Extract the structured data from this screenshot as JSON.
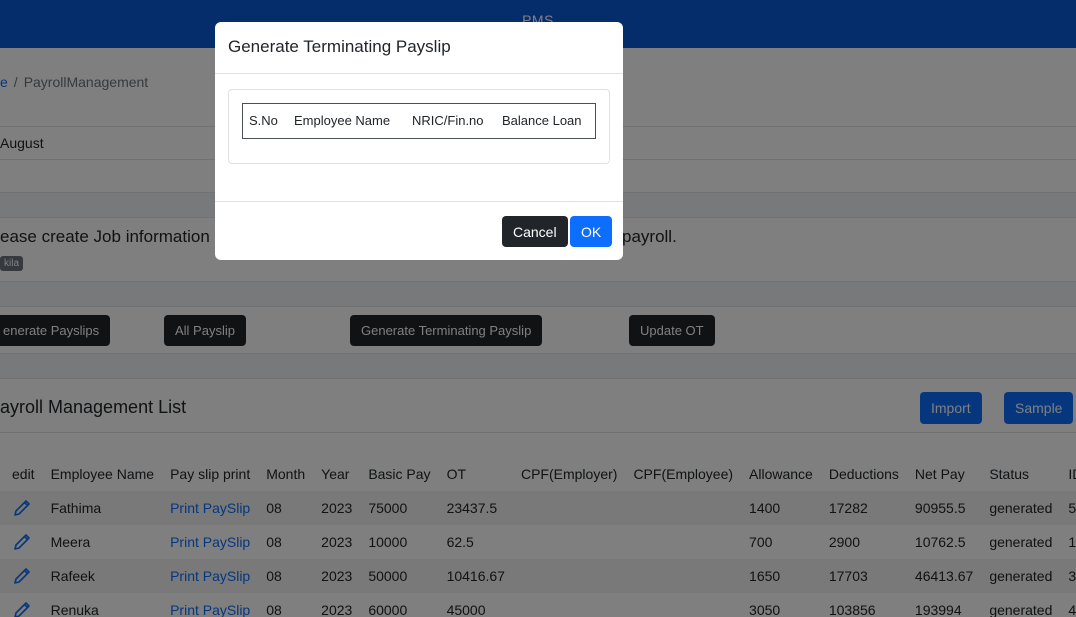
{
  "app": {
    "brand": "PMS"
  },
  "breadcrumb": {
    "home": "e",
    "current": "PayrollManagement"
  },
  "filters": {
    "month": "August"
  },
  "info": {
    "message_start": "ease create Job information re",
    "message_end": "payroll.",
    "badge": "kila"
  },
  "actions": {
    "generate_payslips": "enerate Payslips",
    "all_payslip": "All Payslip",
    "generate_terminating": "Generate Terminating Payslip",
    "update_ot": "Update OT"
  },
  "list": {
    "title": "ayroll Management List",
    "import_label": "Import",
    "sample_label": "Sample",
    "columns": [
      "edit",
      "Employee Name",
      "Pay slip print",
      "Month",
      "Year",
      "Basic Pay",
      "OT",
      "CPF(Employer)",
      "CPF(Employee)",
      "Allowance",
      "Deductions",
      "Net Pay",
      "Status",
      "ID"
    ],
    "rows": [
      {
        "name": "Fathima",
        "print": "Print PaySlip",
        "month": "08",
        "year": "2023",
        "basic": "75000",
        "ot": "23437.5",
        "cpf_er": "",
        "cpf_ee": "",
        "allowance": "1400",
        "deductions": "17282",
        "net": "90955.5",
        "status": "generated",
        "id": "5"
      },
      {
        "name": "Meera",
        "print": "Print PaySlip",
        "month": "08",
        "year": "2023",
        "basic": "10000",
        "ot": "62.5",
        "cpf_er": "",
        "cpf_ee": "",
        "allowance": "700",
        "deductions": "2900",
        "net": "10762.5",
        "status": "generated",
        "id": "1"
      },
      {
        "name": "Rafeek",
        "print": "Print PaySlip",
        "month": "08",
        "year": "2023",
        "basic": "50000",
        "ot": "10416.67",
        "cpf_er": "",
        "cpf_ee": "",
        "allowance": "1650",
        "deductions": "17703",
        "net": "46413.67",
        "status": "generated",
        "id": "3"
      },
      {
        "name": "Renuka",
        "print": "Print PaySlip",
        "month": "08",
        "year": "2023",
        "basic": "60000",
        "ot": "45000",
        "cpf_er": "",
        "cpf_ee": "",
        "allowance": "3050",
        "deductions": "103856",
        "net": "193994",
        "status": "generated",
        "id": "4"
      }
    ]
  },
  "modal": {
    "title": "Generate Terminating Payslip",
    "columns": [
      "S.No",
      "Employee Name",
      "NRIC/Fin.no",
      "Balance Loan"
    ],
    "cancel_label": "Cancel",
    "ok_label": "OK"
  },
  "colors": {
    "brand": "#0d5ad7",
    "primary": "#0d6efd",
    "dark": "#212529"
  }
}
